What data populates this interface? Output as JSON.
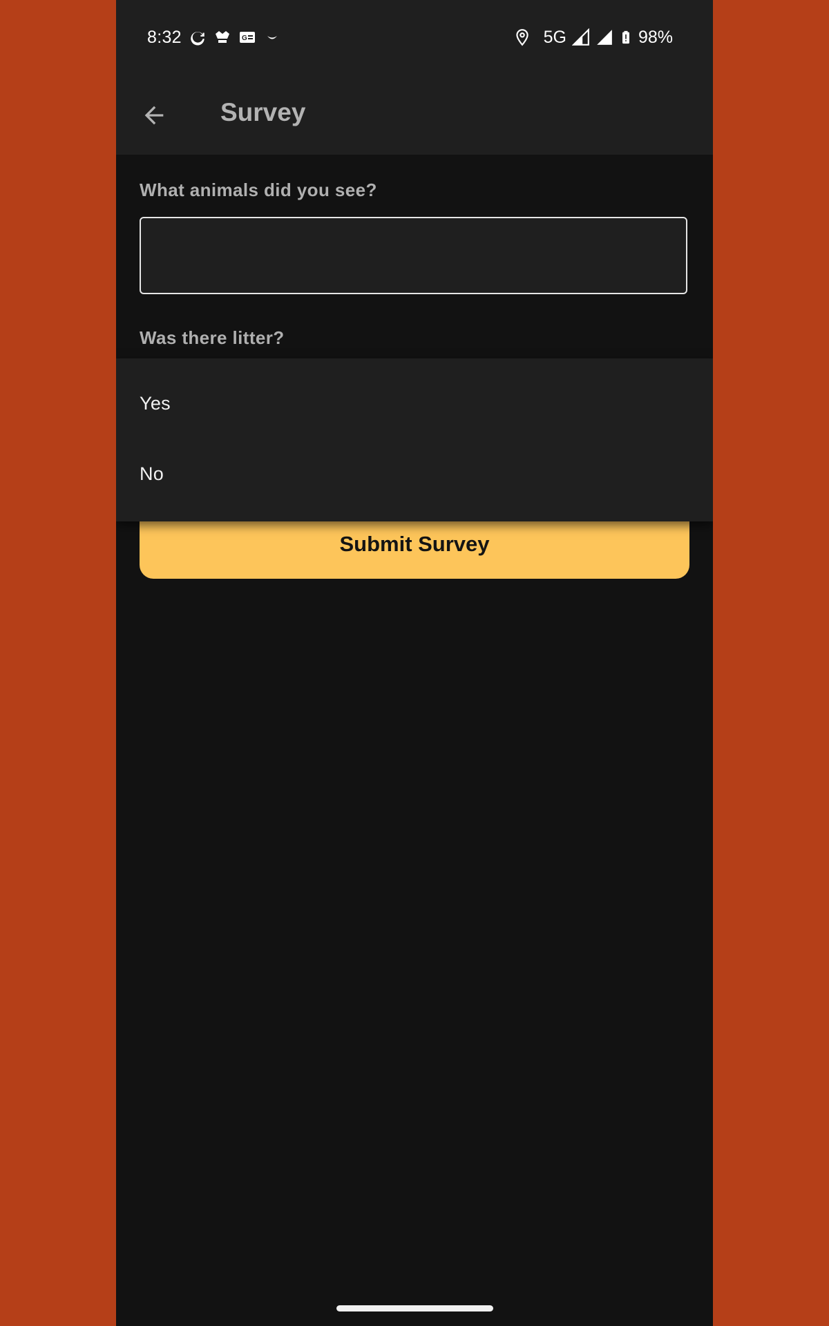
{
  "status_bar": {
    "time": "8:32",
    "network": "5G",
    "battery": "98%",
    "notification_icons": [
      "sync-icon",
      "fool-app-icon",
      "news-icon",
      "smile-icon"
    ],
    "system_icons": [
      "location-icon",
      "signal-icon",
      "signal-icon",
      "battery-icon"
    ]
  },
  "app_bar": {
    "title": "Survey",
    "back_icon": "arrow-left-icon"
  },
  "form": {
    "question_animals": "What animals did you see?",
    "animals_value": "",
    "question_litter": "Was there litter?",
    "submit_label": "Submit Survey"
  },
  "dropdown": {
    "options": [
      {
        "label": "Yes"
      },
      {
        "label": "No"
      }
    ]
  },
  "colors": {
    "background_outer": "#b53f18",
    "screen_bg": "#121212",
    "surface": "#1f1f1f",
    "accent": "#fdc55a"
  }
}
